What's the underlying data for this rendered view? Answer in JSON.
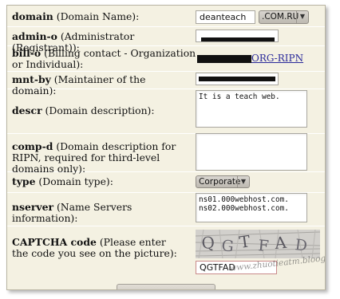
{
  "fields": {
    "domain": {
      "label_bold": "domain",
      "label_rest": " (Domain Name):",
      "value": "deanteach",
      "zone": ".COM.RU"
    },
    "admin_o": {
      "label_bold": "admin-o",
      "label_rest": " (Administrator (Registrant)):"
    },
    "bill_o": {
      "label_bold": "bill-o",
      "label_rest": " (Billing contact - Organization or Individual):",
      "link_suffix": "ORG-RIPN"
    },
    "mnt_by": {
      "label_bold": "mnt-by",
      "label_rest": " (Maintainer of the domain):"
    },
    "descr": {
      "label_bold": "descr",
      "label_rest": " (Domain description):",
      "value": "It is a teach web."
    },
    "comp_d": {
      "label_bold": "comp-d",
      "label_rest": " (Domain description for RIPN, required for third-level domains only):",
      "value": ""
    },
    "type": {
      "label_bold": "type",
      "label_rest": " (Domain type):",
      "value": "Corporate"
    },
    "nserver": {
      "label_bold": "nserver",
      "label_rest": " (Name Servers information):",
      "value": "ns01.000webhost.com.\nns02.000webhost.com."
    },
    "captcha": {
      "label_bold": "CAPTCHA code",
      "label_rest": " (Please enter the code you see on the picture):",
      "value": "QGTFAD",
      "watermark": "www.zhuotieatm.bloogs.org"
    }
  },
  "colors": {
    "panel_bg": "#f4f1e2",
    "redaction": "#111111",
    "link": "#2a2a9a"
  }
}
